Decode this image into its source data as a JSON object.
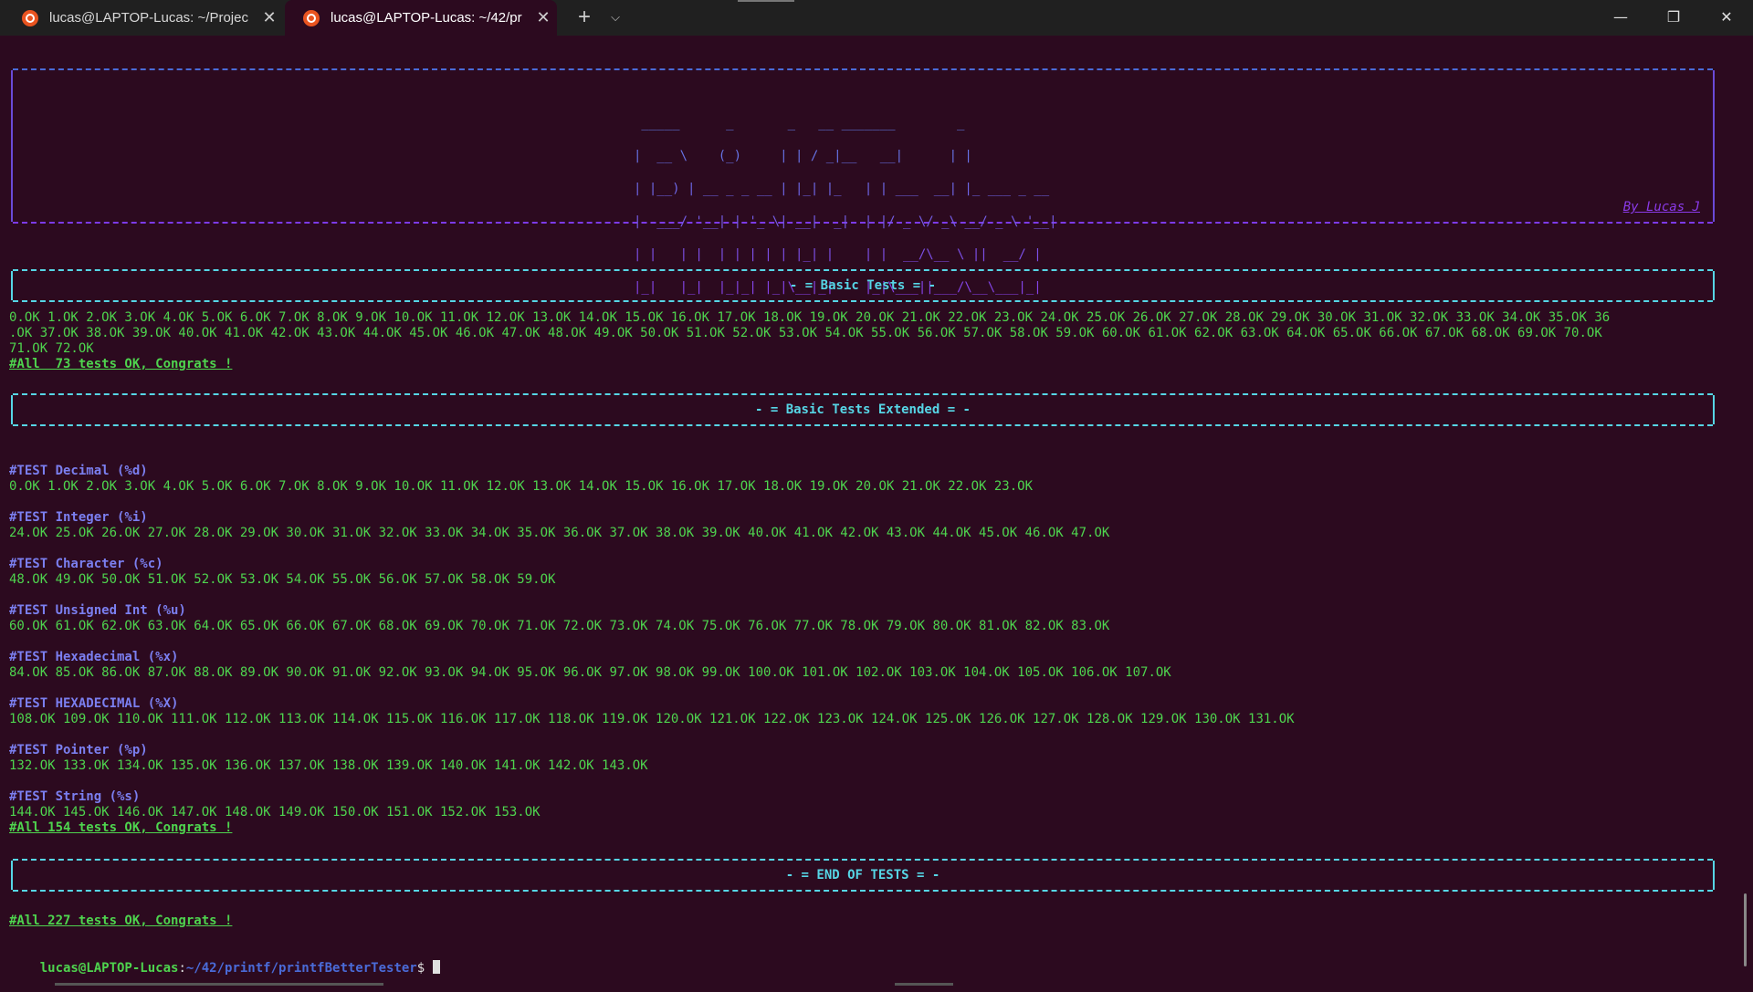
{
  "tabs": [
    {
      "label": "lucas@LAPTOP-Lucas: ~/Projec",
      "icon": "ubuntu-icon",
      "active": false
    },
    {
      "label": "lucas@LAPTOP-Lucas: ~/42/pr",
      "icon": "ubuntu-icon",
      "active": true
    }
  ],
  "titlebar": {
    "new_tab": "+",
    "dropdown": "⌵",
    "minimize": "—",
    "maximize": "❐",
    "close": "✕"
  },
  "banner": {
    "ascii": [
      " _____      _       _   __ _______        _           ",
      "|  __ \\    (_)     | | / _|__   __|      | |          ",
      "| |__) | __ _ _ __ | |_| |_   | | ___  __| |_ ___ _ __",
      "|  ___/ '__| | '_ \\| __|  _|  | |/ _ \\/ _\\ __/ _ \\ '__|",
      "| |   | |  | | | | | |_| |    | |  __/\\__ \\ ||  __/ |  ",
      "|_|   |_|  |_|_| |_|\\__|_|    |_|\\___||___/\\__\\___|_|  "
    ],
    "author": "By Lucas J"
  },
  "sections": {
    "basic": "- = Basic Tests = -",
    "extended": "- = Basic Tests Extended = -",
    "end": "- = END OF TESTS = -"
  },
  "basic_results": [
    "0.OK 1.OK 2.OK 3.OK 4.OK 5.OK 6.OK 7.OK 8.OK 9.OK 10.OK 11.OK 12.OK 13.OK 14.OK 15.OK 16.OK 17.OK 18.OK 19.OK 20.OK 21.OK 22.OK 23.OK 24.OK 25.OK 26.OK 27.OK 28.OK 29.OK 30.OK 31.OK 32.OK 33.OK 34.OK 35.OK 36",
    ".OK 37.OK 38.OK 39.OK 40.OK 41.OK 42.OK 43.OK 44.OK 45.OK 46.OK 47.OK 48.OK 49.OK 50.OK 51.OK 52.OK 53.OK 54.OK 55.OK 56.OK 57.OK 58.OK 59.OK 60.OK 61.OK 62.OK 63.OK 64.OK 65.OK 66.OK 67.OK 68.OK 69.OK 70.OK",
    "71.OK 72.OK"
  ],
  "basic_congrats": "#All  73 tests OK, Congrats !",
  "tests": [
    {
      "title": "#TEST Decimal (%d)",
      "results": "0.OK 1.OK 2.OK 3.OK 4.OK 5.OK 6.OK 7.OK 8.OK 9.OK 10.OK 11.OK 12.OK 13.OK 14.OK 15.OK 16.OK 17.OK 18.OK 19.OK 20.OK 21.OK 22.OK 23.OK"
    },
    {
      "title": "#TEST Integer (%i)",
      "results": "24.OK 25.OK 26.OK 27.OK 28.OK 29.OK 30.OK 31.OK 32.OK 33.OK 34.OK 35.OK 36.OK 37.OK 38.OK 39.OK 40.OK 41.OK 42.OK 43.OK 44.OK 45.OK 46.OK 47.OK"
    },
    {
      "title": "#TEST Character (%c)",
      "results": "48.OK 49.OK 50.OK 51.OK 52.OK 53.OK 54.OK 55.OK 56.OK 57.OK 58.OK 59.OK"
    },
    {
      "title": "#TEST Unsigned Int (%u)",
      "results": "60.OK 61.OK 62.OK 63.OK 64.OK 65.OK 66.OK 67.OK 68.OK 69.OK 70.OK 71.OK 72.OK 73.OK 74.OK 75.OK 76.OK 77.OK 78.OK 79.OK 80.OK 81.OK 82.OK 83.OK"
    },
    {
      "title": "#TEST Hexadecimal (%x)",
      "results": "84.OK 85.OK 86.OK 87.OK 88.OK 89.OK 90.OK 91.OK 92.OK 93.OK 94.OK 95.OK 96.OK 97.OK 98.OK 99.OK 100.OK 101.OK 102.OK 103.OK 104.OK 105.OK 106.OK 107.OK"
    },
    {
      "title": "#TEST HEXADECIMAL (%X)",
      "results": "108.OK 109.OK 110.OK 111.OK 112.OK 113.OK 114.OK 115.OK 116.OK 117.OK 118.OK 119.OK 120.OK 121.OK 122.OK 123.OK 124.OK 125.OK 126.OK 127.OK 128.OK 129.OK 130.OK 131.OK"
    },
    {
      "title": "#TEST Pointer (%p)",
      "results": "132.OK 133.OK 134.OK 135.OK 136.OK 137.OK 138.OK 139.OK 140.OK 141.OK 142.OK 143.OK"
    },
    {
      "title": "#TEST String (%s)",
      "results": "144.OK 145.OK 146.OK 147.OK 148.OK 149.OK 150.OK 151.OK 152.OK 153.OK"
    }
  ],
  "extended_congrats": "#All 154 tests OK, Congrats !",
  "final_congrats": "#All 227 tests OK, Congrats !",
  "prompt": {
    "user": "lucas@LAPTOP-Lucas",
    "sep": ":",
    "path": "~/42/printf/printfBetterTester",
    "sign": "$ "
  },
  "colors": {
    "background": "#2c0a1f",
    "ok": "#4ed44e",
    "test_title": "#7b7ff0",
    "box": "#56d6e6",
    "author": "#8a3ae8"
  }
}
